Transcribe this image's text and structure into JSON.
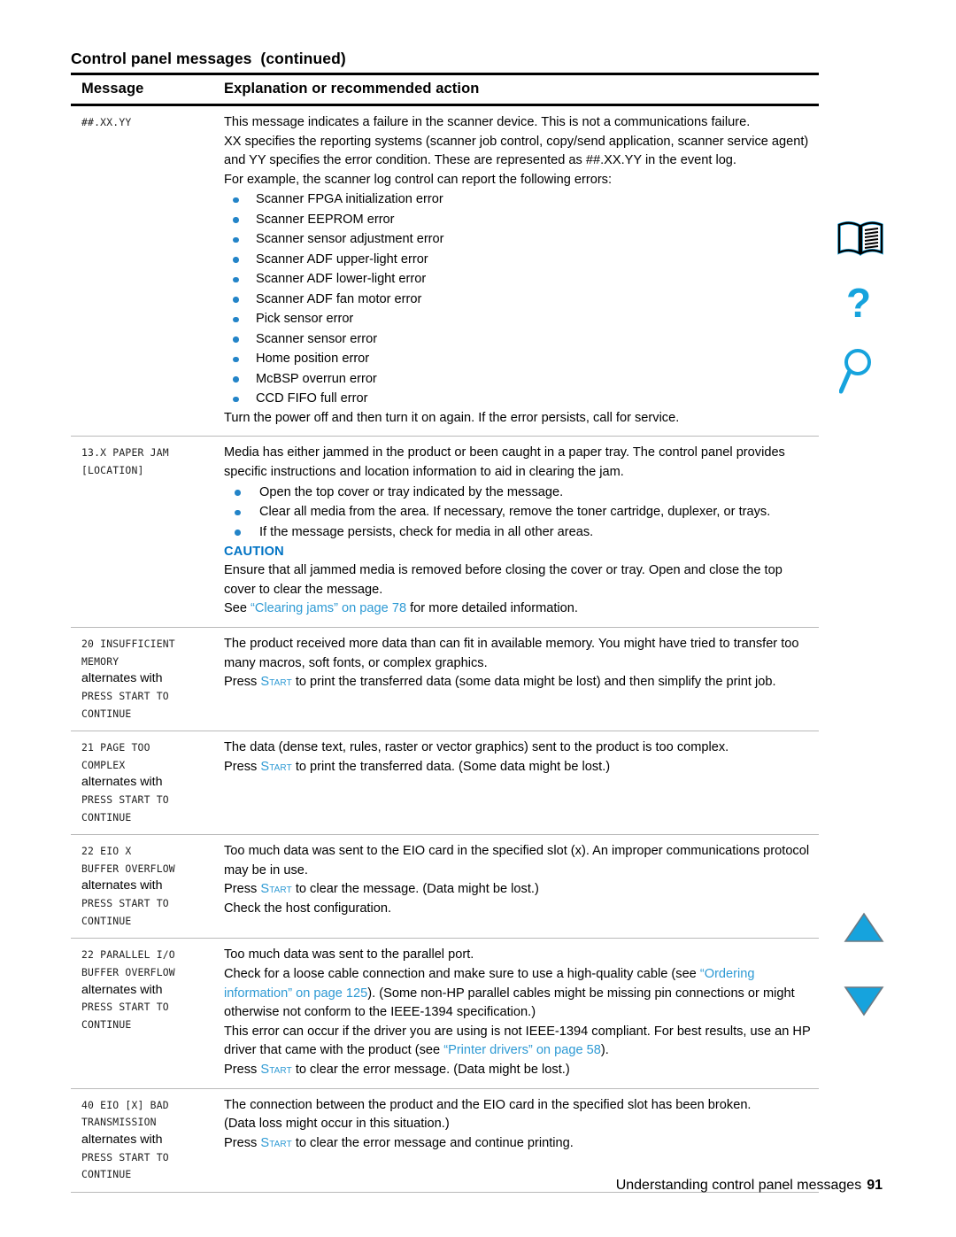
{
  "document": {
    "title_main": "Control panel messages",
    "title_continued": "(continued)",
    "footer_text": "Understanding control panel messages",
    "page_number": "91"
  },
  "colors": {
    "link": "#2e9ad4",
    "caution": "#0073c4",
    "bullet": "#2384c8",
    "icon_cyan": "#16a3dd",
    "rule_dark": "#000000",
    "rule_light": "#b9b9b9"
  },
  "table": {
    "headers": {
      "message": "Message",
      "explanation": "Explanation or recommended action"
    },
    "rows": [
      {
        "message_lines": [
          "##.XX.YY"
        ],
        "alternates_label": null,
        "alternate_lines": [],
        "paragraphs": [
          "This message indicates a failure in the scanner device. This is not a communications failure.",
          "XX specifies the reporting systems (scanner job control, copy/send application, scanner service agent) and YY specifies the error condition. These are represented as ##.XX.YY in the event log.",
          "For example, the scanner log control can report the following errors:"
        ],
        "bullets": [
          "Scanner FPGA initialization error",
          "Scanner EEPROM error",
          "Scanner sensor adjustment error",
          "Scanner ADF upper-light error",
          "Scanner ADF lower-light error",
          "Scanner ADF fan motor error",
          "Pick sensor error",
          "Scanner sensor error",
          "Home position error",
          "McBSP overrun error",
          "CCD FIFO full error"
        ],
        "after_bullets": [
          "Turn the power off and then turn it on again. If the error persists, call for service."
        ]
      },
      {
        "message_lines": [
          "13.X PAPER JAM",
          "[LOCATION]"
        ],
        "alternates_label": null,
        "alternate_lines": [],
        "paragraphs": [
          "Media has either jammed in the product or been caught in a paper tray. The control panel provides specific instructions and location information to aid in clearing the jam."
        ],
        "bullets": [
          "Open the top cover or tray indicated by the message.",
          "Clear all media from the area. If necessary, remove the toner cartridge, duplexer, or trays.",
          "If the message persists, check for media in all other areas."
        ],
        "caution_label": "CAUTION",
        "caution_text": "Ensure that all jammed media is removed before closing the cover or tray. Open and close the top cover to clear the message.",
        "see_prefix": "See ",
        "see_link": "“Clearing jams” on page 78",
        "see_suffix": " for more detailed information."
      },
      {
        "message_lines": [
          "20 INSUFFICIENT",
          "MEMORY"
        ],
        "alternates_label": "alternates with",
        "alternate_lines": [
          "PRESS START TO",
          "CONTINUE"
        ],
        "paragraphs": [
          "The product received more data than can fit in available memory. You might have tried to transfer too many macros, soft fonts, or complex graphics."
        ],
        "press_start": {
          "prefix": "Press ",
          "key": "Start",
          "suffix": " to print the transferred data (some data might be lost) and then simplify the print job."
        }
      },
      {
        "message_lines": [
          "21 PAGE TOO",
          "COMPLEX"
        ],
        "alternates_label": "alternates with",
        "alternate_lines": [
          "PRESS START TO",
          "CONTINUE"
        ],
        "paragraphs": [
          "The data (dense text, rules, raster or vector graphics) sent to the product is too complex."
        ],
        "press_start": {
          "prefix": "Press ",
          "key": "Start",
          "suffix": " to print the transferred data. (Some data might be lost.)"
        }
      },
      {
        "message_lines": [
          "22 EIO X",
          "BUFFER OVERFLOW"
        ],
        "alternates_label": "alternates with",
        "alternate_lines": [
          "PRESS START TO",
          "CONTINUE"
        ],
        "paragraphs": [
          "Too much data was sent to the EIO card in the specified slot (x). An improper communications protocol may be in use."
        ],
        "press_start": {
          "prefix": "Press ",
          "key": "Start",
          "suffix": " to clear the message. (Data might be lost.)"
        },
        "trailing_paragraphs": [
          "Check the host configuration."
        ]
      },
      {
        "message_lines": [
          "22 PARALLEL I/O",
          "BUFFER OVERFLOW"
        ],
        "alternates_label": "alternates with",
        "alternate_lines": [
          "PRESS START TO",
          "CONTINUE"
        ],
        "paragraphs": [
          "Too much data was sent to the parallel port."
        ],
        "rich_p1": {
          "a": "Check for a loose cable connection and make sure to use a high-quality cable (see ",
          "link": "“Ordering information” on page 125",
          "b": "). (Some non-HP parallel cables might be missing pin connections or might otherwise not conform to the IEEE-1394 specification.)"
        },
        "rich_p2": {
          "a": "This error can occur if the driver you are using is not IEEE-1394 compliant. For best results, use an HP driver that came with the product (see ",
          "link": "“Printer drivers” on page 58",
          "b": ")."
        },
        "press_start": {
          "prefix": "Press ",
          "key": "Start",
          "suffix": " to clear the error message. (Data might be lost.)"
        }
      },
      {
        "message_lines": [
          "40 EIO [X] BAD",
          "TRANSMISSION"
        ],
        "alternates_label": "alternates with",
        "alternate_lines": [
          "PRESS START TO",
          "CONTINUE"
        ],
        "paragraphs": [
          "The connection between the product and the EIO card in the specified slot has been broken.",
          "(Data loss might occur in this situation.)"
        ],
        "press_start": {
          "prefix": "Press ",
          "key": "Start",
          "suffix": " to clear the error message and continue printing."
        }
      }
    ]
  },
  "margin_icons": [
    {
      "name": "book-icon",
      "label": "open-book"
    },
    {
      "name": "question-mark-icon",
      "label": "question-mark"
    },
    {
      "name": "magnifier-icon",
      "label": "magnifying-glass"
    },
    {
      "name": "arrow-up-icon",
      "label": "triangle-up"
    },
    {
      "name": "arrow-down-icon",
      "label": "triangle-down"
    }
  ]
}
